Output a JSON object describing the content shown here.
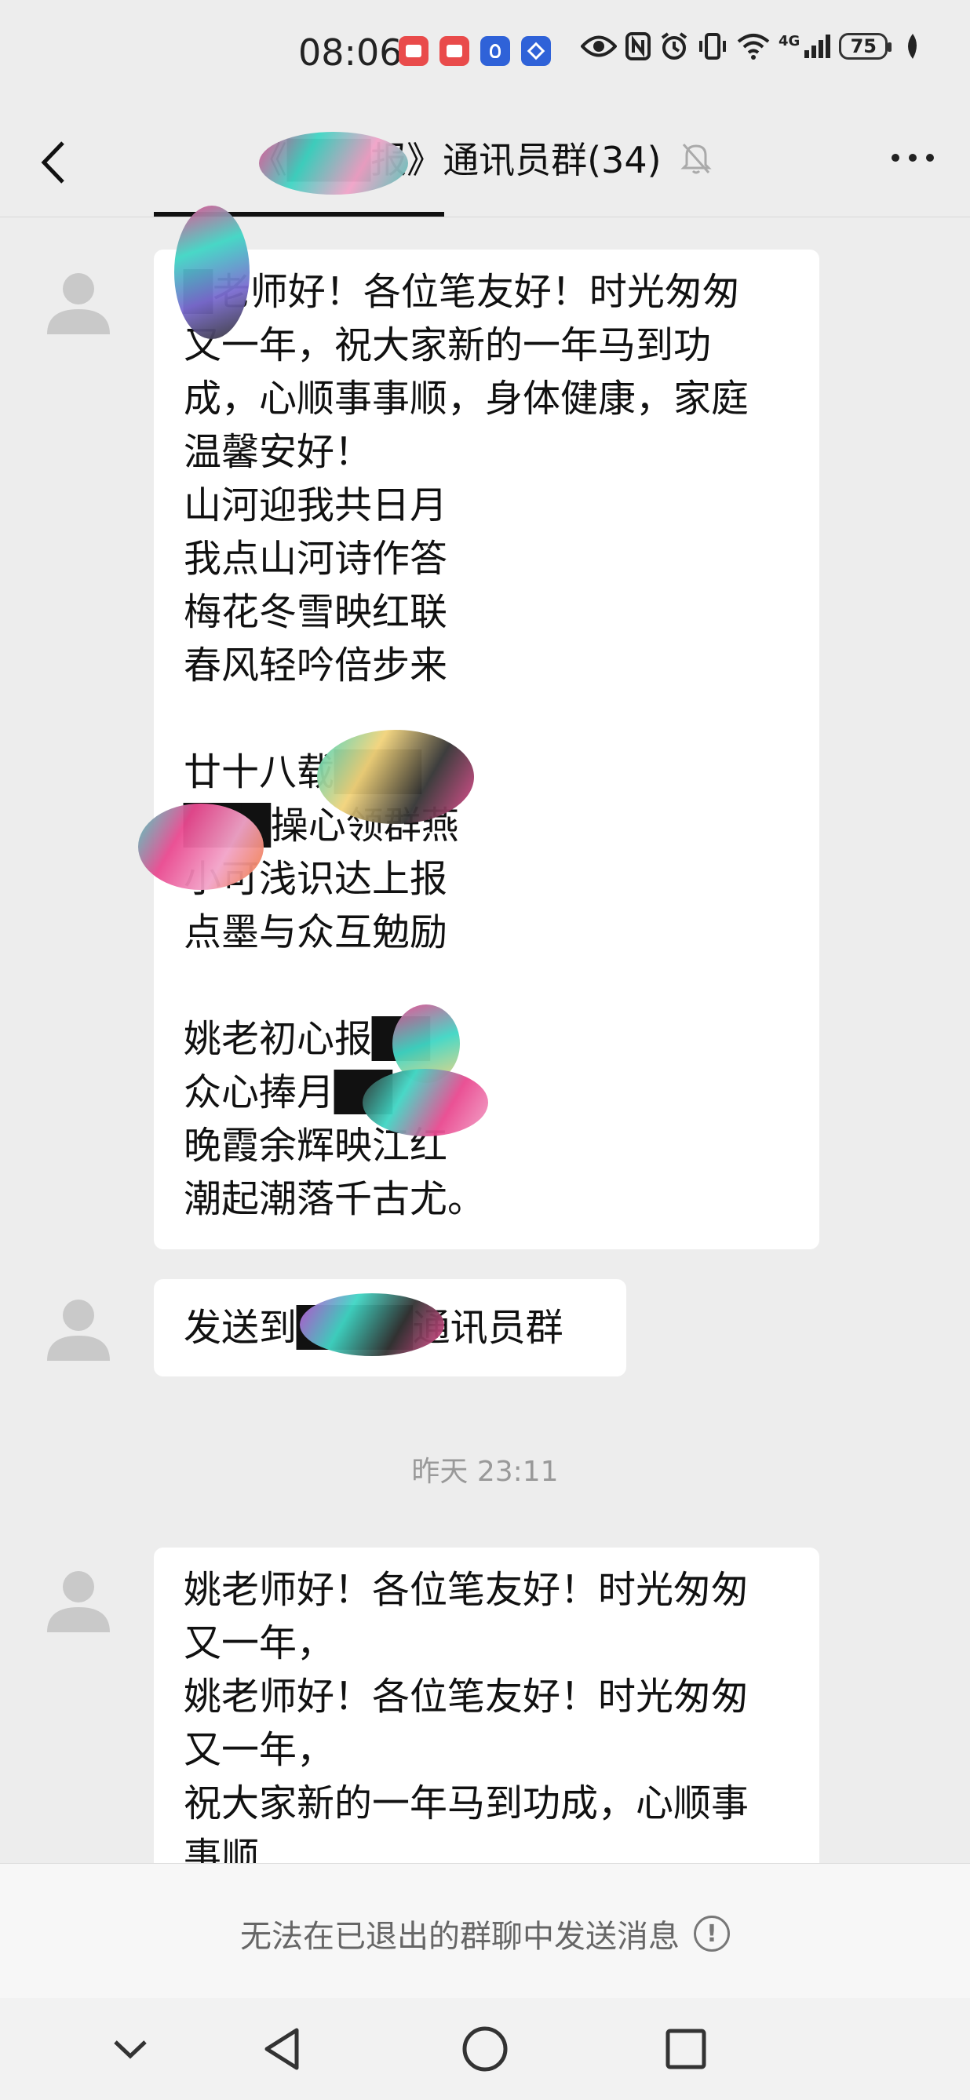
{
  "status_bar": {
    "time": "08:06",
    "battery": "75",
    "network": "4G"
  },
  "header": {
    "title": "《███报》通讯员群(34)",
    "icons": [
      "back-icon",
      "mute-bell-icon",
      "more-icon"
    ]
  },
  "messages": [
    {
      "lines": [
        "█老师好！各位笔友好！时光匆匆",
        "又一年，祝大家新的一年马到功",
        "成，心顺事事顺，身体健康，家庭",
        "温馨安好！",
        "山河迎我共日月",
        "我点山河诗作答",
        "梅花冬雪映红联",
        "春风轻吟倍步来",
        "",
        "廿十八载███",
        "███操心领群燕",
        "小可浅识达上报",
        "点墨与众互勉励",
        "",
        "姚老初心报██",
        "众心捧月██",
        "晚霞余辉映江红",
        "潮起潮落千古尤。"
      ]
    },
    {
      "lines": [
        "发送到████通讯员群"
      ]
    },
    {
      "lines": [
        "姚老师好！各位笔友好！时光匆匆",
        "又一年，",
        "姚老师好！各位笔友好！时光匆匆",
        "又一年，",
        "祝大家新的一年马到功成，心顺事",
        "事顺"
      ]
    }
  ],
  "timestamp": "昨天 23:11",
  "footer": {
    "notice": "无法在已退出的群聊中发送消息",
    "notice_icon": "!"
  },
  "colors": {
    "background": "#ededed",
    "bubble": "#ffffff",
    "avatar": "#c9c9c9"
  }
}
